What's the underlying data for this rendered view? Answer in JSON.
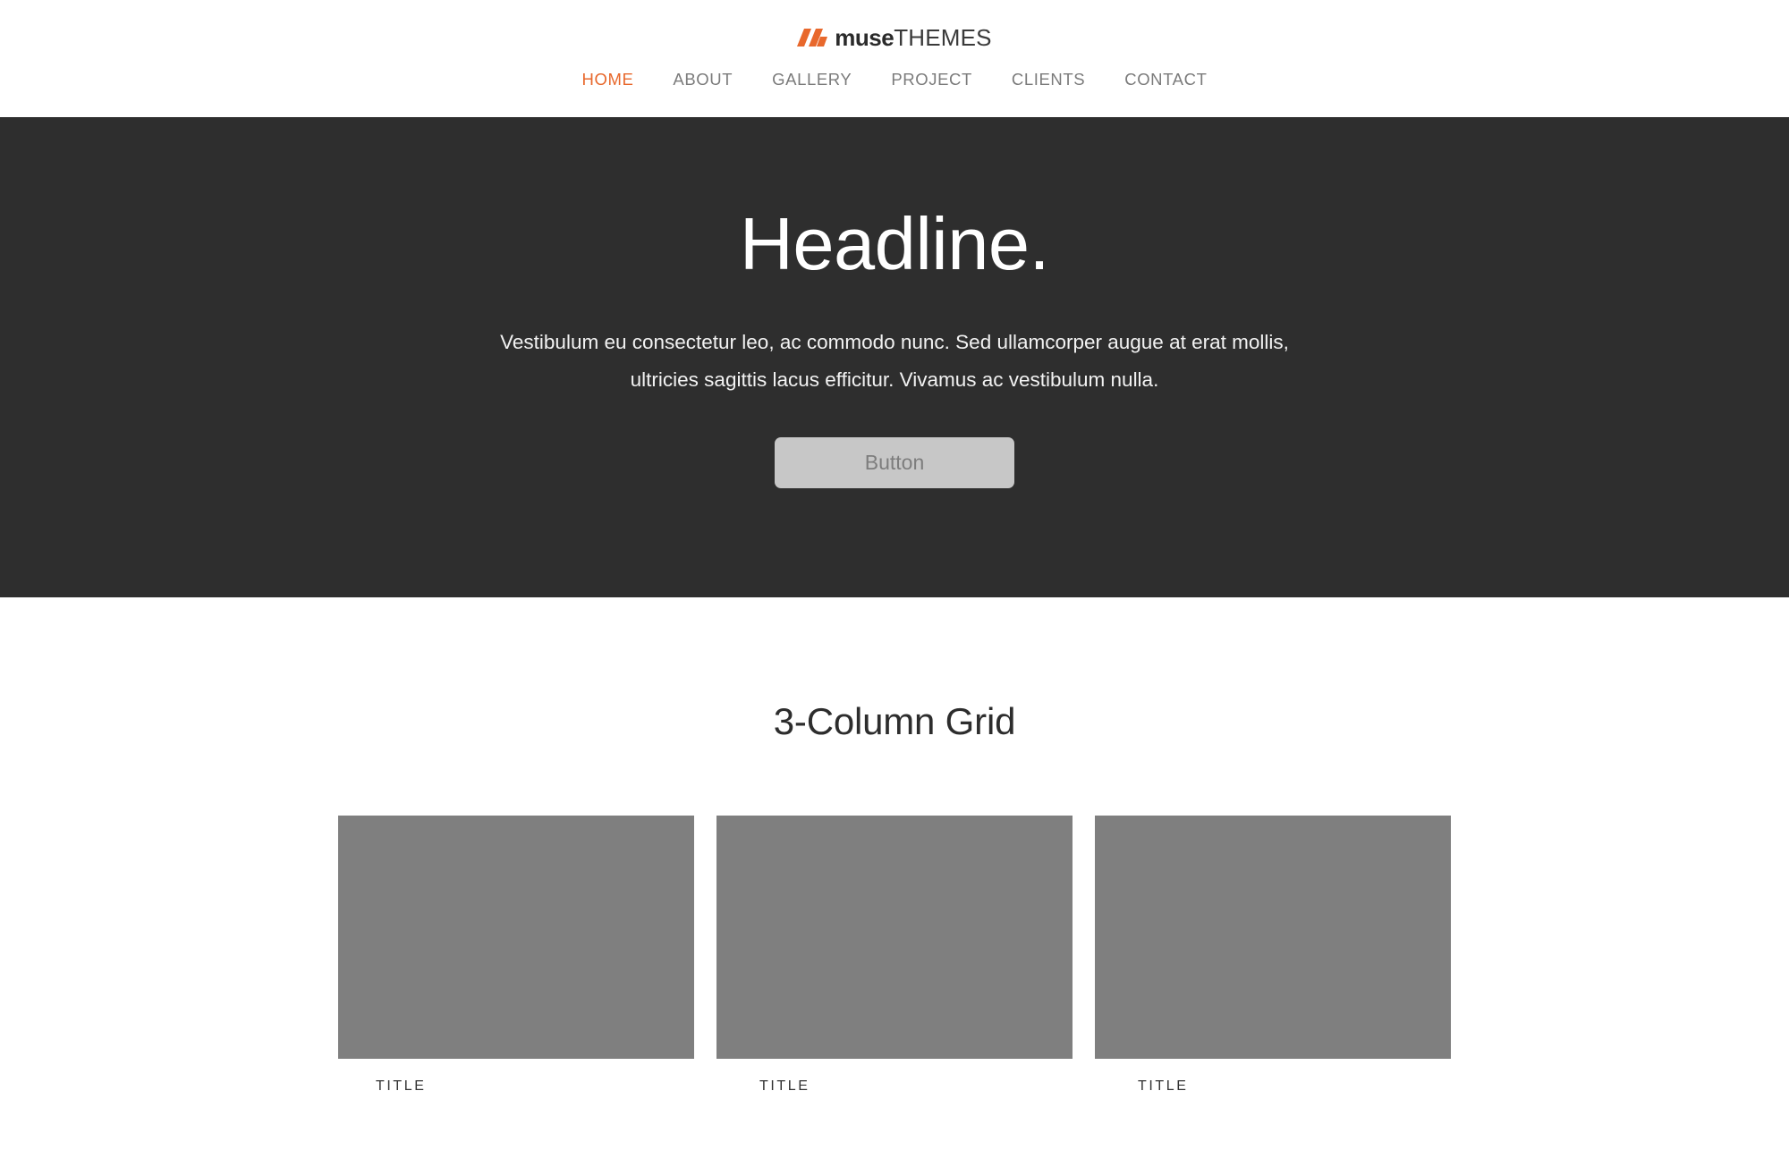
{
  "header": {
    "logo": {
      "mark_icon": "muse-slashes-icon",
      "brand_bold": "muse",
      "brand_light": "THEMES",
      "accent_color": "#e8682c"
    },
    "nav": {
      "items": [
        {
          "label": "HOME",
          "active": true
        },
        {
          "label": "ABOUT",
          "active": false
        },
        {
          "label": "GALLERY",
          "active": false
        },
        {
          "label": "PROJECT",
          "active": false
        },
        {
          "label": "CLIENTS",
          "active": false
        },
        {
          "label": "CONTACT",
          "active": false
        }
      ]
    }
  },
  "hero": {
    "background_color": "#2e2e2e",
    "headline": "Headline.",
    "subtext": "Vestibulum eu consectetur leo, ac commodo nunc. Sed ullamcorper augue at erat mollis, ultricies sagittis lacus efficitur. Vivamus ac vestibulum nulla.",
    "button_label": "Button",
    "button_color": "#c7c7c7",
    "button_text_color": "#7d7d7d"
  },
  "grid_section": {
    "title": "3-Column Grid",
    "placeholder_color": "#7f7f7f",
    "cells": [
      {
        "caption": "TITLE",
        "image_alt": "placeholder-image"
      },
      {
        "caption": "TITLE",
        "image_alt": "placeholder-image"
      },
      {
        "caption": "TITLE",
        "image_alt": "placeholder-image"
      }
    ]
  }
}
